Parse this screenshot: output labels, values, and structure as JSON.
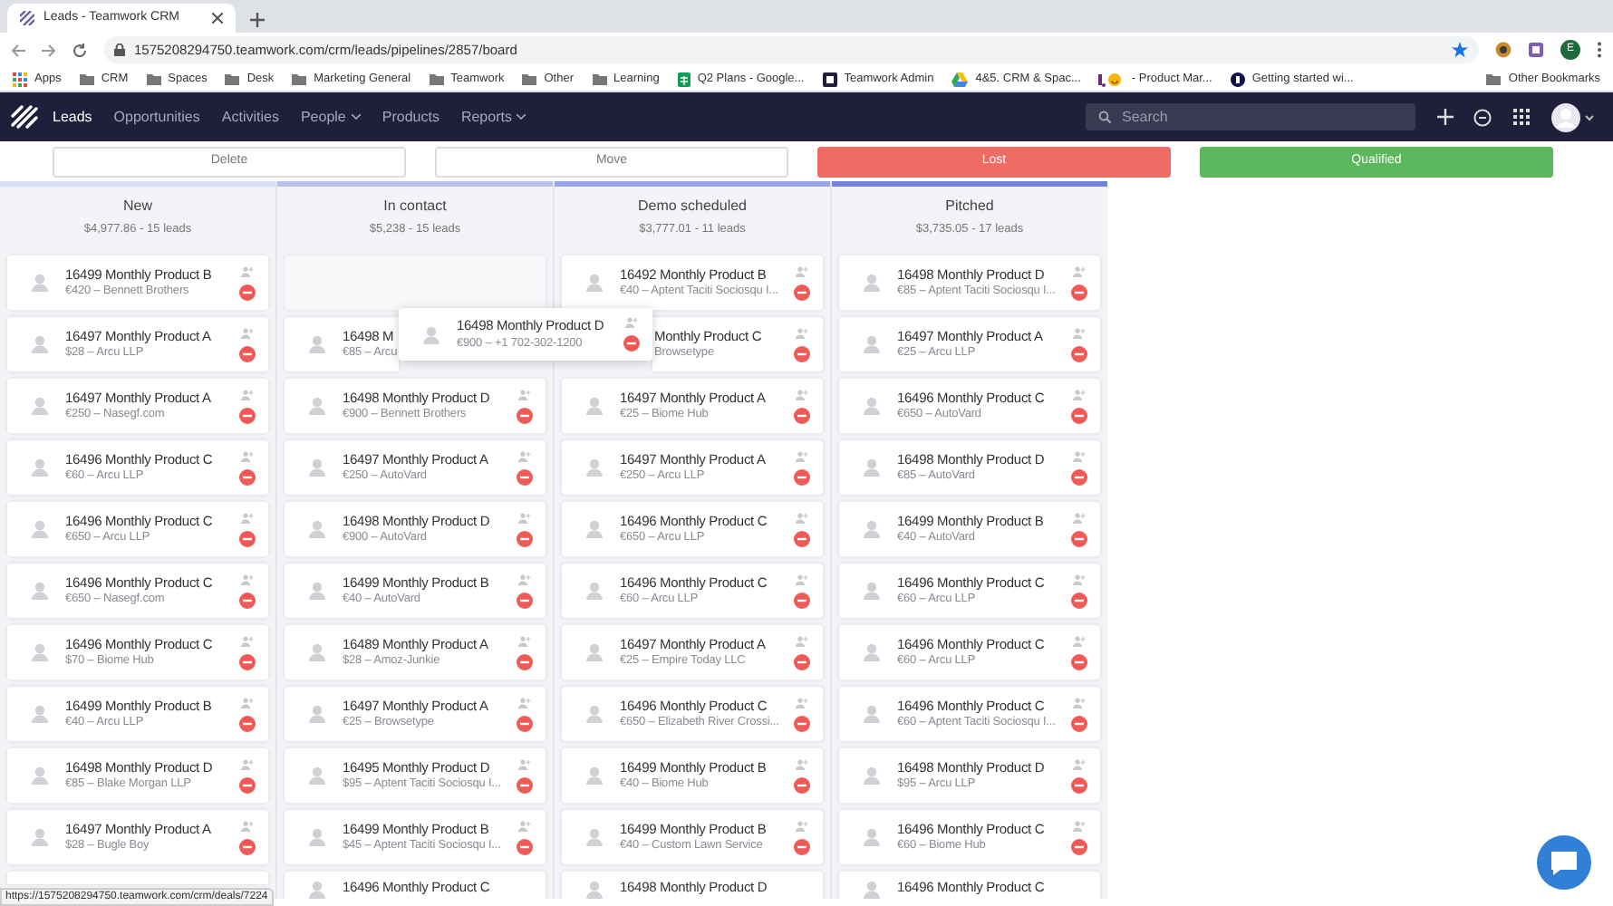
{
  "browser": {
    "tab_title": "Leads - Teamwork CRM",
    "url": "1575208294750.teamwork.com/crm/leads/pipelines/2857/board",
    "profile_initial": "E",
    "bookmarks": [
      {
        "kind": "apps",
        "label": "Apps"
      },
      {
        "kind": "folder",
        "label": "CRM"
      },
      {
        "kind": "folder",
        "label": "Spaces"
      },
      {
        "kind": "folder",
        "label": "Desk"
      },
      {
        "kind": "folder",
        "label": "Marketing General"
      },
      {
        "kind": "folder",
        "label": "Teamwork"
      },
      {
        "kind": "folder",
        "label": "Other"
      },
      {
        "kind": "folder",
        "label": "Learning"
      },
      {
        "kind": "sheet",
        "label": "Q2 Plans - Google..."
      },
      {
        "kind": "tw",
        "label": "Teamwork Admin"
      },
      {
        "kind": "drive",
        "label": "4&5. CRM & Spac..."
      },
      {
        "kind": "smile",
        "label": "- Product Mar..."
      },
      {
        "kind": "dot",
        "label": "Getting started wi..."
      }
    ],
    "other_bookmarks": "Other Bookmarks",
    "status_url": "https://1575208294750.teamwork.com/crm/deals/7224"
  },
  "nav": {
    "items": [
      {
        "label": "Leads",
        "selected": true,
        "dropdown": false
      },
      {
        "label": "Opportunities",
        "selected": false,
        "dropdown": false
      },
      {
        "label": "Activities",
        "selected": false,
        "dropdown": false
      },
      {
        "label": "People",
        "selected": false,
        "dropdown": true
      },
      {
        "label": "Products",
        "selected": false,
        "dropdown": false
      },
      {
        "label": "Reports",
        "selected": false,
        "dropdown": true
      }
    ],
    "search": {
      "placeholder": "Search"
    }
  },
  "actions": [
    {
      "label": "Delete",
      "kind": "plain"
    },
    {
      "label": "Move",
      "kind": "plain"
    },
    {
      "label": "Lost",
      "kind": "lost"
    },
    {
      "label": "Qualified",
      "kind": "won"
    }
  ],
  "columns": [
    {
      "title": "New",
      "summary": "$4,977.86 - 15 leads",
      "color": "#d9defa",
      "cards": [
        {
          "kind": "card",
          "title": "16499 Monthly Product B",
          "subtitle": "€420 – Bennett Brothers"
        },
        {
          "kind": "card",
          "title": "16497 Monthly Product A",
          "subtitle": "$28 – Arcu LLP"
        },
        {
          "kind": "card",
          "title": "16497 Monthly Product A",
          "subtitle": "€250 – Nasegf.com"
        },
        {
          "kind": "card",
          "title": "16496 Monthly Product C",
          "subtitle": "€60 – Arcu LLP"
        },
        {
          "kind": "card",
          "title": "16496 Monthly Product C",
          "subtitle": "€650 – Arcu LLP"
        },
        {
          "kind": "card",
          "title": "16496 Monthly Product C",
          "subtitle": "€650 – Nasegf.com"
        },
        {
          "kind": "card",
          "title": "16496 Monthly Product C",
          "subtitle": "$70 – Biome Hub"
        },
        {
          "kind": "card",
          "title": "16499 Monthly Product B",
          "subtitle": "€40 – Arcu LLP"
        },
        {
          "kind": "card",
          "title": "16498 Monthly Product D",
          "subtitle": "€85 – Blake Morgan LLP"
        },
        {
          "kind": "card",
          "title": "16497 Monthly Product A",
          "subtitle": "$28 – Bugle Boy"
        },
        {
          "kind": "blank"
        }
      ]
    },
    {
      "title": "In contact",
      "summary": "$5,238 - 15 leads",
      "color": "#bac2ef",
      "cards": [
        {
          "kind": "placeholder"
        },
        {
          "kind": "left-visible",
          "title": "16498 M",
          "subtitle": "€85 – Arcu"
        },
        {
          "kind": "card",
          "title": "16498 Monthly Product D",
          "subtitle": "€900 – Bennett Brothers"
        },
        {
          "kind": "card",
          "title": "16497 Monthly Product A",
          "subtitle": "€250 – AutoVard"
        },
        {
          "kind": "card",
          "title": "16498 Monthly Product D",
          "subtitle": "€900 – AutoVard"
        },
        {
          "kind": "card",
          "title": "16499 Monthly Product B",
          "subtitle": "€40 – AutoVard"
        },
        {
          "kind": "card",
          "title": "16489 Monthly Product A",
          "subtitle": "$28 – Amoz-Junkie"
        },
        {
          "kind": "card",
          "title": "16497 Monthly Product A",
          "subtitle": "€25 – Browsetype"
        },
        {
          "kind": "card",
          "title": "16495 Monthly Product D",
          "subtitle": "$95 – Aptent Taciti Sociosqu I..."
        },
        {
          "kind": "card",
          "title": "16499 Monthly Product B",
          "subtitle": "$45 – Aptent Taciti Sociosqu I..."
        },
        {
          "kind": "cut",
          "title": "16496 Monthly Product C"
        }
      ]
    },
    {
      "title": "Demo scheduled",
      "summary": "$3,777.01 - 11 leads",
      "color": "#9aa5e6",
      "cards": [
        {
          "kind": "card",
          "title": "16492 Monthly Product B",
          "subtitle": "€40 – Aptent Taciti Sociosqu I..."
        },
        {
          "kind": "covered",
          "title": "Monthly Product C",
          "subtitle": "Browsetype"
        },
        {
          "kind": "card",
          "title": "16497 Monthly Product A",
          "subtitle": "€25 – Biome Hub"
        },
        {
          "kind": "card",
          "title": "16497 Monthly Product A",
          "subtitle": "€250 – Arcu LLP"
        },
        {
          "kind": "card",
          "title": "16496 Monthly Product C",
          "subtitle": "€650 – Arcu LLP"
        },
        {
          "kind": "card",
          "title": "16496 Monthly Product C",
          "subtitle": "€60 – Arcu LLP"
        },
        {
          "kind": "card",
          "title": "16497 Monthly Product A",
          "subtitle": "€25 – Empire Today LLC"
        },
        {
          "kind": "card",
          "title": "16496 Monthly Product C",
          "subtitle": "€650 – Elizabeth River Crossi..."
        },
        {
          "kind": "card",
          "title": "16499 Monthly Product B",
          "subtitle": "€40 – Biome Hub"
        },
        {
          "kind": "card",
          "title": "16499 Monthly Product B",
          "subtitle": "€40 – Custom Lawn Service"
        },
        {
          "kind": "cut",
          "title": "16498 Monthly Product D"
        }
      ]
    },
    {
      "title": "Pitched",
      "summary": "$3,735.05 - 17 leads",
      "color": "#7482d9",
      "cards": [
        {
          "kind": "card",
          "title": "16498 Monthly Product D",
          "subtitle": "€85 – Aptent Taciti Sociosqu I..."
        },
        {
          "kind": "card",
          "title": "16497 Monthly Product A",
          "subtitle": "€25 – Arcu LLP"
        },
        {
          "kind": "card",
          "title": "16496 Monthly Product C",
          "subtitle": "€650 – AutoVard"
        },
        {
          "kind": "card",
          "title": "16498 Monthly Product D",
          "subtitle": "€85 – AutoVard"
        },
        {
          "kind": "card",
          "title": "16499 Monthly Product B",
          "subtitle": "€40 – AutoVard"
        },
        {
          "kind": "card",
          "title": "16496 Monthly Product C",
          "subtitle": "€60 – Arcu LLP"
        },
        {
          "kind": "card",
          "title": "16496 Monthly Product C",
          "subtitle": "€60 – Arcu LLP"
        },
        {
          "kind": "card",
          "title": "16496 Monthly Product C",
          "subtitle": "€60 – Aptent Taciti Sociosqu I..."
        },
        {
          "kind": "card",
          "title": "16498 Monthly Product D",
          "subtitle": "$95 – Arcu LLP"
        },
        {
          "kind": "card",
          "title": "16496 Monthly Product C",
          "subtitle": "€60 – Biome Hub"
        },
        {
          "kind": "cut",
          "title": "16496 Monthly Product C"
        }
      ]
    }
  ],
  "dragged_card": {
    "title": "16498 Monthly Product D",
    "subtitle": "€900 – +1 702-302-1200"
  }
}
